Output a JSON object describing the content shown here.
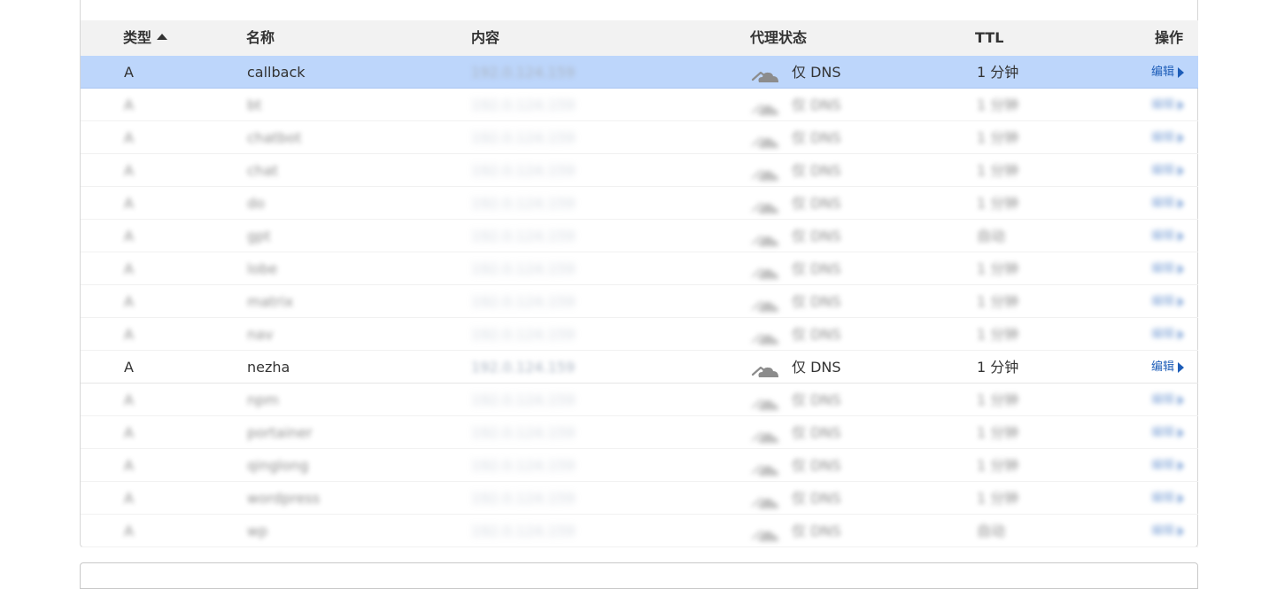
{
  "table": {
    "columns": {
      "type": "类型",
      "name": "名称",
      "content": "内容",
      "proxy": "代理状态",
      "ttl": "TTL",
      "action": "操作"
    },
    "rows": [
      {
        "type": "A",
        "name": "callback",
        "content": "192.0.124.159",
        "proxy": "仅 DNS",
        "ttl": "1 分钟",
        "action": "编辑",
        "state": "selected"
      },
      {
        "type": "A",
        "name": "bt",
        "content": "192.0.124.159",
        "proxy": "仅 DNS",
        "ttl": "1 分钟",
        "action": "编辑",
        "state": "blur"
      },
      {
        "type": "A",
        "name": "chatbot",
        "content": "192.0.124.159",
        "proxy": "仅 DNS",
        "ttl": "1 分钟",
        "action": "编辑",
        "state": "blur"
      },
      {
        "type": "A",
        "name": "chat",
        "content": "192.0.124.159",
        "proxy": "仅 DNS",
        "ttl": "1 分钟",
        "action": "编辑",
        "state": "blur"
      },
      {
        "type": "A",
        "name": "do",
        "content": "192.0.124.159",
        "proxy": "仅 DNS",
        "ttl": "1 分钟",
        "action": "编辑",
        "state": "blur"
      },
      {
        "type": "A",
        "name": "gpt",
        "content": "192.0.124.159",
        "proxy": "仅 DNS",
        "ttl": "自动",
        "action": "编辑",
        "state": "blur"
      },
      {
        "type": "A",
        "name": "lobe",
        "content": "192.0.124.159",
        "proxy": "仅 DNS",
        "ttl": "1 分钟",
        "action": "编辑",
        "state": "blur"
      },
      {
        "type": "A",
        "name": "matrix",
        "content": "192.0.124.159",
        "proxy": "仅 DNS",
        "ttl": "1 分钟",
        "action": "编辑",
        "state": "blur"
      },
      {
        "type": "A",
        "name": "nav",
        "content": "192.0.124.159",
        "proxy": "仅 DNS",
        "ttl": "1 分钟",
        "action": "编辑",
        "state": "blur"
      },
      {
        "type": "A",
        "name": "nezha",
        "content": "192.0.124.159",
        "proxy": "仅 DNS",
        "ttl": "1 分钟",
        "action": "编辑",
        "state": "normal"
      },
      {
        "type": "A",
        "name": "npm",
        "content": "192.0.124.159",
        "proxy": "仅 DNS",
        "ttl": "1 分钟",
        "action": "编辑",
        "state": "blur"
      },
      {
        "type": "A",
        "name": "portainer",
        "content": "192.0.124.159",
        "proxy": "仅 DNS",
        "ttl": "1 分钟",
        "action": "编辑",
        "state": "blur"
      },
      {
        "type": "A",
        "name": "qinglong",
        "content": "192.0.124.159",
        "proxy": "仅 DNS",
        "ttl": "1 分钟",
        "action": "编辑",
        "state": "blur"
      },
      {
        "type": "A",
        "name": "wordpress",
        "content": "192.0.124.159",
        "proxy": "仅 DNS",
        "ttl": "1 分钟",
        "action": "编辑",
        "state": "blur"
      },
      {
        "type": "A",
        "name": "wp",
        "content": "192.0.124.159",
        "proxy": "仅 DNS",
        "ttl": "自动",
        "action": "编辑",
        "state": "blur"
      }
    ]
  },
  "icons": {
    "proxy": "dns-only-cloud-icon",
    "sort": "sort-ascending-icon",
    "edit_arrow": "play-right-icon"
  },
  "colors": {
    "accent": "#1d5db8",
    "selected_row": "#bdd6fb",
    "header_bg": "#f2f2f2",
    "cloud_gray": "#8c8c8c"
  }
}
